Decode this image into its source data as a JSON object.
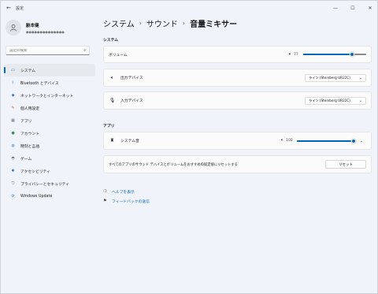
{
  "window": {
    "title": "設定",
    "controls": {
      "minimize": "—",
      "maximize": "☐",
      "close": "✕"
    }
  },
  "user": {
    "name": "齢本健",
    "email": "●●●●●●●●●●●●●●"
  },
  "search": {
    "placeholder": "設定の検索",
    "value": ""
  },
  "sidebar": {
    "items": [
      {
        "label": "システム",
        "icon": "monitor-icon",
        "active": true
      },
      {
        "label": "Bluetooth とデバイス",
        "icon": "bluetooth-icon"
      },
      {
        "label": "ネットワークとインターネット",
        "icon": "network-icon"
      },
      {
        "label": "個人用設定",
        "icon": "pen-icon"
      },
      {
        "label": "アプリ",
        "icon": "apps-icon"
      },
      {
        "label": "アカウント",
        "icon": "account-icon"
      },
      {
        "label": "時刻と言語",
        "icon": "globe-icon"
      },
      {
        "label": "ゲーム",
        "icon": "game-icon"
      },
      {
        "label": "アクセシビリティ",
        "icon": "accessibility-icon"
      },
      {
        "label": "プライバシーとセキュリティ",
        "icon": "shield-icon"
      },
      {
        "label": "Windows Update",
        "icon": "update-icon"
      }
    ]
  },
  "breadcrumb": {
    "level1": "システム",
    "level2": "サウンド",
    "current": "音量ミキサー"
  },
  "system_section": {
    "title": "システム",
    "volume": {
      "label": "ボリューム",
      "value": "77",
      "level": 77
    },
    "output": {
      "label": "出力デバイス",
      "value": "ライン (Steinberg UR22C)"
    },
    "input": {
      "label": "入力デバイス",
      "value": "ライン (Steinberg UR22C)"
    }
  },
  "apps_section": {
    "title": "アプリ",
    "system_sounds": {
      "label": "システム音",
      "value": "100",
      "level": 100
    },
    "reset": {
      "label": "すべてのアプリのサウンド デバイスとボリュームをおすすめの既定値にリセットする",
      "button": "リセット"
    }
  },
  "links": {
    "help": "ヘルプを表示",
    "feedback": "フィードバックの送信"
  },
  "colors": {
    "accent": "#0067c0",
    "background": "#f0f3f9",
    "card": "#fbfbfb"
  }
}
